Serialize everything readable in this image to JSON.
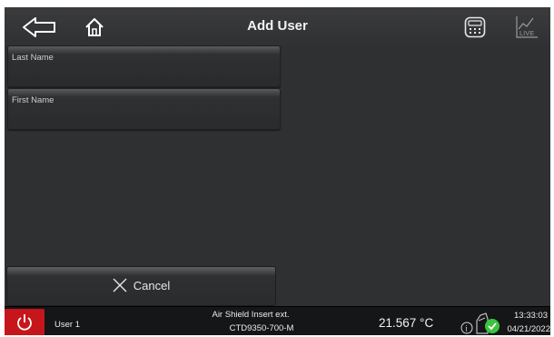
{
  "header": {
    "title": "Add User",
    "back_icon": "arrow-left-icon",
    "home_icon": "home-icon",
    "calc_icon": "calculator-icon",
    "live_icon": "live-chart-icon",
    "live_text": "LIVE"
  },
  "form": {
    "last_name_label": "Last Name",
    "last_name_value": "",
    "first_name_label": "First Name",
    "first_name_value": ""
  },
  "cancel": {
    "label": "Cancel",
    "icon": "close-icon"
  },
  "status": {
    "power_icon": "power-icon",
    "user": "User 1",
    "device_name": "Air Shield Insert ext.",
    "device_model": "CTD9350-700-M",
    "temperature": "21.567 °C",
    "time": "13:33:03",
    "date": "04/21/2022",
    "status_color": "#3cc43c",
    "power_color": "#c6161c"
  }
}
